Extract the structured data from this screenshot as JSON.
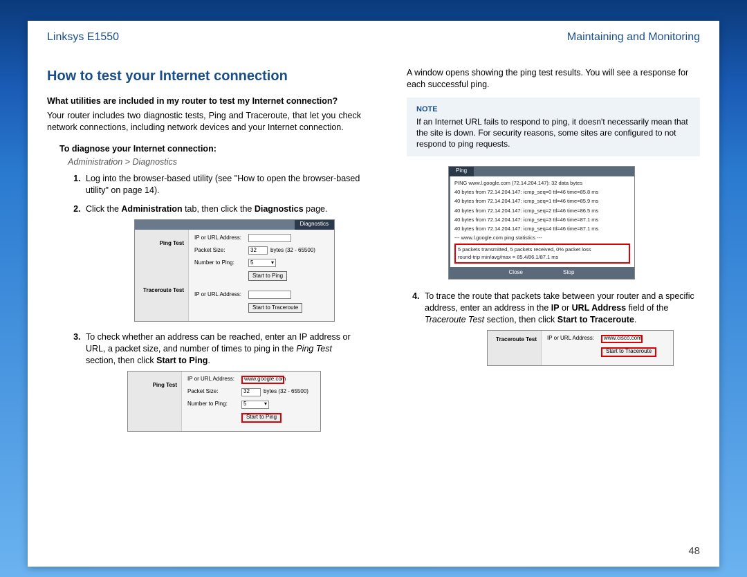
{
  "header": {
    "left": "Linksys E1550",
    "right": "Maintaining and Monitoring"
  },
  "page_number": "48",
  "left": {
    "title": "How to test your Internet connection",
    "question": "What utilities are included in my router to test my Internet connection?",
    "answer": "Your router includes two diagnostic tests, Ping and Traceroute, that let you check network connections, including network devices and your Internet connection.",
    "subhead": "To diagnose your Internet connection:",
    "breadcrumb": "Administration > Diagnostics",
    "step1": "Log into the browser-based utility (see \"How to open the browser-based utility\" on page 14).",
    "step2_a": "Click the ",
    "step2_b": "Administration",
    "step2_c": " tab, then click the ",
    "step2_d": "Diagnostics",
    "step2_e": " page.",
    "shot1": {
      "tab": "Diagnostics",
      "side_ping": "Ping Test",
      "side_trace": "Traceroute Test",
      "ip_label": "IP or URL Address:",
      "packet_label": "Packet Size:",
      "packet_val": "32",
      "packet_hint": "bytes (32 - 65500)",
      "num_label": "Number to Ping:",
      "num_val": "5",
      "start_ping": "Start to Ping",
      "start_trace": "Start to Traceroute"
    },
    "step3_a": "To check whether an address can be reached, enter an IP address or URL, a packet size, and number of times to ping in the ",
    "step3_b": "Ping Test",
    "step3_c": " section, then click ",
    "step3_d": "Start to Ping",
    "step3_e": ".",
    "shot2": {
      "side_ping": "Ping Test",
      "ip_label": "IP or URL Address:",
      "ip_val": "www.google.com",
      "packet_label": "Packet Size:",
      "packet_val": "32",
      "packet_hint": "bytes (32 - 65500)",
      "num_label": "Number to Ping:",
      "num_val": "5",
      "start_ping": "Start to Ping"
    }
  },
  "right": {
    "intro": "A window opens showing the ping test results. You will see a response for each successful ping.",
    "note_title": "NOTE",
    "note_body": "If an Internet URL fails to respond to ping, it doesn't necessarily mean that the site is down. For security reasons, some sites are configured to not respond to ping requests.",
    "ping_window": {
      "tab": "Ping",
      "line0": "PING www.l.google.com (72.14.204.147): 32 data bytes",
      "line1": "40 bytes from 72.14.204.147: icmp_seq=0 ttl=46 time=85.8 ms",
      "line2": "40 bytes from 72.14.204.147: icmp_seq=1 ttl=46 time=85.9 ms",
      "line3": "40 bytes from 72.14.204.147: icmp_seq=2 ttl=46 time=86.5 ms",
      "line4": "40 bytes from 72.14.204.147: icmp_seq=3 ttl=46 time=87.1 ms",
      "line5": "40 bytes from 72.14.204.147: icmp_seq=4 ttl=46 time=87.1 ms",
      "stats_hdr": "--- www.l.google.com ping statistics ---",
      "stats1": "5 packets transmitted, 5 packets received, 0% packet loss",
      "stats2": "round-trip min/avg/max = 85.4/86.1/87.1 ms",
      "close": "Close",
      "stop": "Stop"
    },
    "step4_a": "To trace the route that packets take between your router and a specific address, enter an address in the ",
    "step4_b": "IP",
    "step4_c": " or ",
    "step4_d": "URL Address",
    "step4_e": " field of the ",
    "step4_f": "Traceroute Test",
    "step4_g": " section, then click ",
    "step4_h": "Start to Traceroute",
    "step4_i": ".",
    "trace_shot": {
      "side": "Traceroute Test",
      "ip_label": "IP or URL Address:",
      "ip_val": "www.cisco.com",
      "btn": "Start to Traceroute"
    }
  }
}
